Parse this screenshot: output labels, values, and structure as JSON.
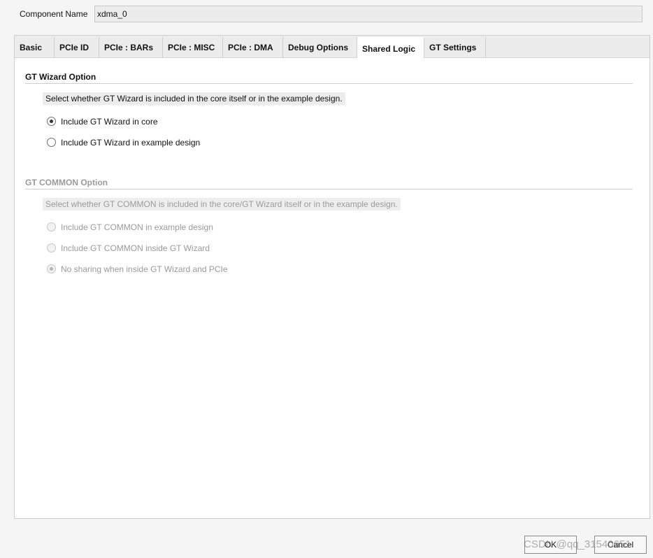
{
  "component": {
    "label": "Component Name",
    "value": "xdma_0"
  },
  "tabs": [
    {
      "label": "Basic",
      "active": false
    },
    {
      "label": "PCIe ID",
      "active": false
    },
    {
      "label": "PCIe : BARs",
      "active": false
    },
    {
      "label": "PCIe : MISC",
      "active": false
    },
    {
      "label": "PCIe : DMA",
      "active": false
    },
    {
      "label": "Debug Options",
      "active": false
    },
    {
      "label": "Shared Logic",
      "active": true
    },
    {
      "label": "GT Settings",
      "active": false
    }
  ],
  "gt_wizard": {
    "title": "GT Wizard Option",
    "description": "Select whether GT Wizard is included in the core itself or in the example design.",
    "options": [
      {
        "label": "Include GT Wizard in core",
        "selected": true
      },
      {
        "label": "Include GT Wizard in example design",
        "selected": false
      }
    ]
  },
  "gt_common": {
    "title": "GT COMMON Option",
    "description": "Select whether GT COMMON is included in the core/GT Wizard itself or in the example design.",
    "enabled": false,
    "options": [
      {
        "label": "Include GT COMMON in example design",
        "selected": false
      },
      {
        "label": "Include GT COMMON inside GT Wizard",
        "selected": false
      },
      {
        "label": "No sharing when inside GT Wizard and PCIe",
        "selected": true
      }
    ]
  },
  "buttons": {
    "ok": "OK",
    "cancel": "Cancel"
  },
  "watermark": "CSDN @qq_31540651"
}
